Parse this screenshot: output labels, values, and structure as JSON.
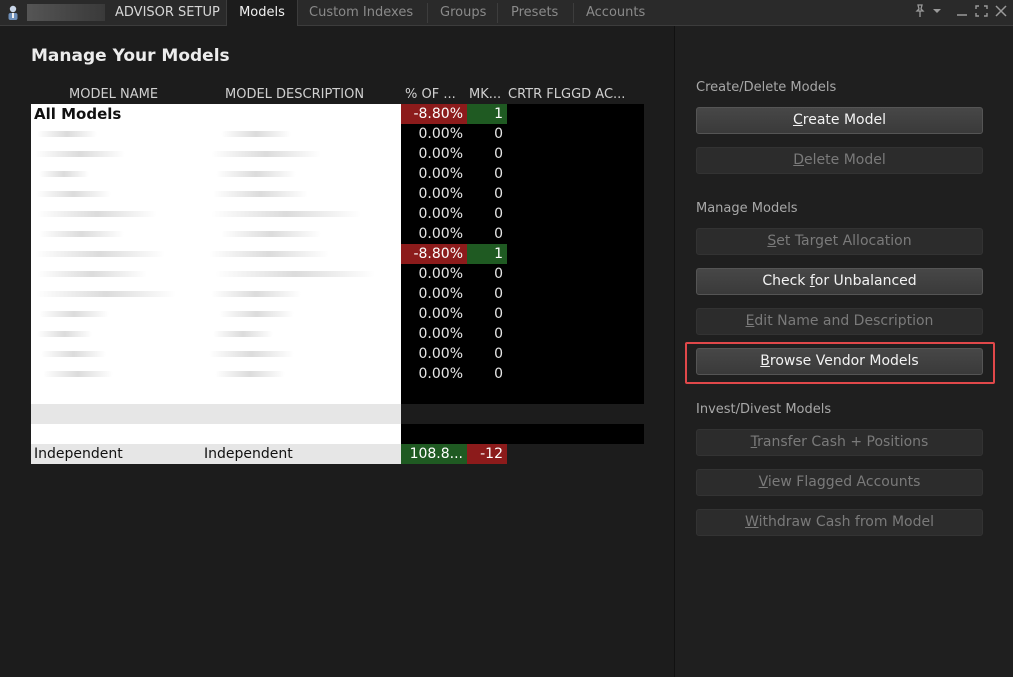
{
  "tabs": {
    "advisor_setup": "ADVISOR SETUP",
    "models": "Models",
    "custom_indexes": "Custom Indexes",
    "groups": "Groups",
    "presets": "Presets",
    "accounts": "Accounts"
  },
  "window_controls": {
    "pin": "📌",
    "dropdown": "▾",
    "minimize": "—",
    "maximize": "⛶",
    "close": "✕"
  },
  "main": {
    "title": "Manage Your Models",
    "columns": {
      "model_name": "MODEL NAME",
      "model_description": "MODEL DESCRIPTION",
      "pct_of": "% OF ...",
      "mkt": "MK...",
      "rest": "CRTR FLGGD AC..."
    },
    "all_models_row": {
      "name": "All Models",
      "pct": "-8.80%",
      "mkt": "1"
    },
    "rows": [
      {
        "pct": "0.00%",
        "mkt": "0"
      },
      {
        "pct": "0.00%",
        "mkt": "0"
      },
      {
        "pct": "0.00%",
        "mkt": "0"
      },
      {
        "pct": "0.00%",
        "mkt": "0"
      },
      {
        "pct": "0.00%",
        "mkt": "0"
      },
      {
        "pct": "0.00%",
        "mkt": "0"
      },
      {
        "pct": "-8.80%",
        "mkt": "1"
      },
      {
        "pct": "0.00%",
        "mkt": "0"
      },
      {
        "pct": "0.00%",
        "mkt": "0"
      },
      {
        "pct": "0.00%",
        "mkt": "0"
      },
      {
        "pct": "0.00%",
        "mkt": "0"
      },
      {
        "pct": "0.00%",
        "mkt": "0"
      },
      {
        "pct": "0.00%",
        "mkt": "0"
      }
    ],
    "independent_row": {
      "name": "Independent",
      "description": "Independent",
      "pct": "108.8...",
      "mkt": "-12"
    }
  },
  "sidebar": {
    "create_delete_label": "Create/Delete Models",
    "manage_label": "Manage Models",
    "invest_label": "Invest/Divest Models",
    "buttons": {
      "create_model_u": "C",
      "create_model_rest": "reate Model",
      "delete_model_u": "D",
      "delete_model_rest": "elete Model",
      "set_target_u": "S",
      "set_target_rest": "et Target Allocation",
      "check_unbalanced_pre": "Check ",
      "check_unbalanced_u": "f",
      "check_unbalanced_rest": "or Unbalanced",
      "edit_name_u": "E",
      "edit_name_rest": "dit Name and Description",
      "browse_vendor_u": "B",
      "browse_vendor_rest": "rowse Vendor Models",
      "transfer_cash_u": "T",
      "transfer_cash_rest": "ransfer Cash + Positions",
      "view_flagged_u": "V",
      "view_flagged_rest": "iew Flagged Accounts",
      "withdraw_cash_u": "W",
      "withdraw_cash_rest": "ithdraw Cash from Model"
    }
  }
}
